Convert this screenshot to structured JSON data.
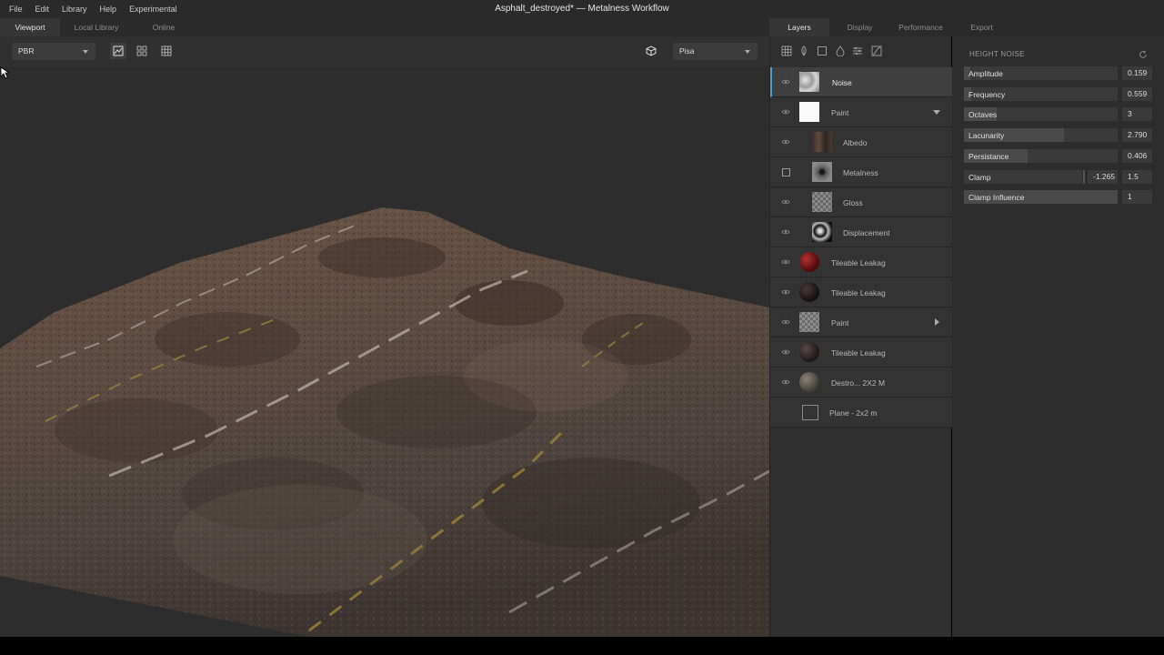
{
  "menu": [
    "File",
    "Edit",
    "Library",
    "Help",
    "Experimental"
  ],
  "window_title": "Asphalt_destroyed* — Metalness Workflow",
  "left_tabs": [
    "Viewport",
    "Local Library",
    "Online"
  ],
  "viewport": {
    "render_mode": "PBR",
    "environment": "Pisa"
  },
  "panel_tabs": [
    "Layers",
    "Display",
    "Performance",
    "Export"
  ],
  "layers": [
    {
      "name": "Noise",
      "visible": true,
      "thumb": "noise"
    },
    {
      "name": "Paint",
      "visible": true,
      "thumb": "white",
      "expanded": true
    },
    {
      "name": "Albedo",
      "visible": true,
      "thumb": "albedo",
      "child": true
    },
    {
      "name": "Metalness",
      "visible": false,
      "thumb": "metal",
      "child": true
    },
    {
      "name": "Gloss",
      "visible": true,
      "thumb": "checker",
      "child": true
    },
    {
      "name": "Displacement",
      "visible": true,
      "thumb": "disp",
      "child": true
    },
    {
      "name": "Tileable Leakag",
      "visible": true,
      "thumb": "red-sphere"
    },
    {
      "name": "Tileable Leakag",
      "visible": true,
      "thumb": "dark-sphere"
    },
    {
      "name": "Paint",
      "visible": true,
      "thumb": "checker",
      "collapsed": true
    },
    {
      "name": "Tileable Leakag",
      "visible": true,
      "thumb": "dark-sphere"
    },
    {
      "name": "Destro... 2X2 M",
      "visible": true,
      "thumb": "gray-sphere"
    },
    {
      "name": "Plane - 2x2 m",
      "visible": null,
      "thumb": "square"
    }
  ],
  "properties": {
    "section": "HEIGHT NOISE",
    "params": [
      {
        "label": "Amplitude",
        "value": "0.159",
        "fill": 0.04
      },
      {
        "label": "Frequency",
        "value": "0.559",
        "fill": 0.05
      },
      {
        "label": "Octaves",
        "value": "3",
        "fill": 0.21
      },
      {
        "label": "Lacunarity",
        "value": "2.790",
        "fill": 0.65
      },
      {
        "label": "Persistance",
        "value": "0.406",
        "fill": 0.41
      },
      {
        "label": "Clamp",
        "value": "-1.265",
        "value2": "1.5",
        "fill": 0.0
      },
      {
        "label": "Clamp Influence",
        "value": "1",
        "fill": 1.0
      }
    ]
  }
}
